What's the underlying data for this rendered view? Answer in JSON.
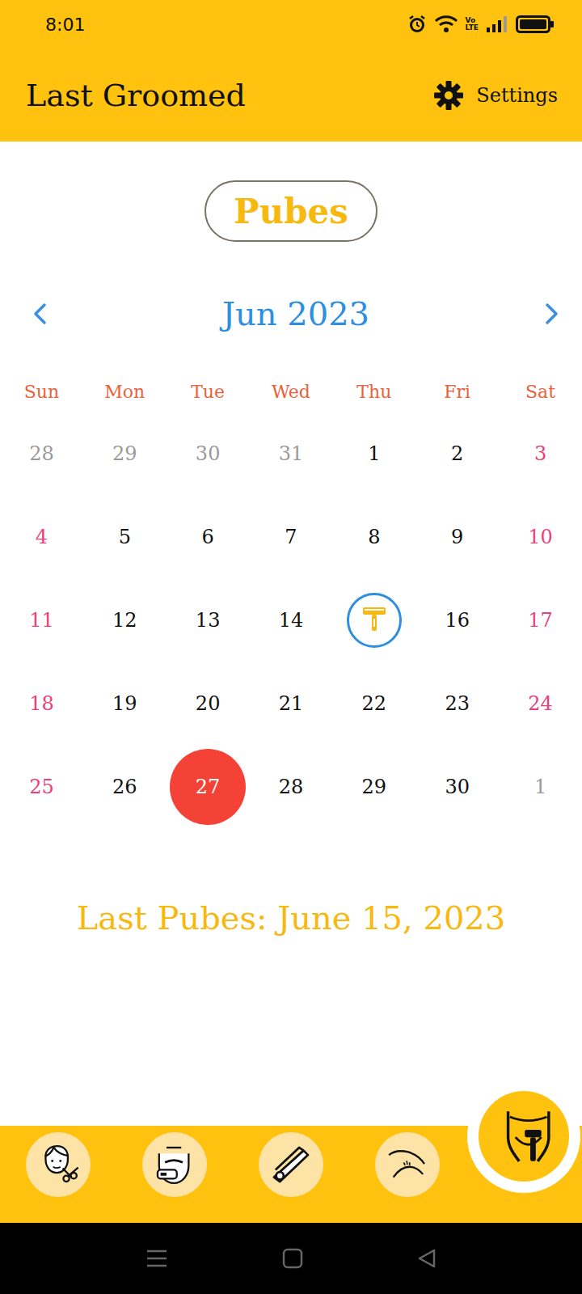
{
  "status_bar": {
    "time": "8:01",
    "network": [
      "Vo",
      "LTE"
    ]
  },
  "app_bar": {
    "title": "Last Groomed",
    "settings": "Settings"
  },
  "category": "Pubes",
  "calendar": {
    "month": "Jun 2023",
    "weekdays": [
      "Sun",
      "Mon",
      "Tue",
      "Wed",
      "Thu",
      "Fri",
      "Sat"
    ],
    "weeks": [
      [
        {
          "day": "28",
          "kind": "outside"
        },
        {
          "day": "29",
          "kind": "outside"
        },
        {
          "day": "30",
          "kind": "outside"
        },
        {
          "day": "31",
          "kind": "outside"
        },
        {
          "day": "1",
          "kind": "weekday"
        },
        {
          "day": "2",
          "kind": "weekday"
        },
        {
          "day": "3",
          "kind": "weekend"
        }
      ],
      [
        {
          "day": "4",
          "kind": "weekend"
        },
        {
          "day": "5",
          "kind": "weekday"
        },
        {
          "day": "6",
          "kind": "weekday"
        },
        {
          "day": "7",
          "kind": "weekday"
        },
        {
          "day": "8",
          "kind": "weekday"
        },
        {
          "day": "9",
          "kind": "weekday"
        },
        {
          "day": "10",
          "kind": "weekend"
        }
      ],
      [
        {
          "day": "11",
          "kind": "weekend"
        },
        {
          "day": "12",
          "kind": "weekday"
        },
        {
          "day": "13",
          "kind": "weekday"
        },
        {
          "day": "14",
          "kind": "weekday"
        },
        {
          "kind": "groomed"
        },
        {
          "day": "16",
          "kind": "weekday"
        },
        {
          "day": "17",
          "kind": "weekend"
        }
      ],
      [
        {
          "day": "18",
          "kind": "weekend"
        },
        {
          "day": "19",
          "kind": "weekday"
        },
        {
          "day": "20",
          "kind": "weekday"
        },
        {
          "day": "21",
          "kind": "weekday"
        },
        {
          "day": "22",
          "kind": "weekday"
        },
        {
          "day": "23",
          "kind": "weekday"
        },
        {
          "day": "24",
          "kind": "weekend"
        }
      ],
      [
        {
          "day": "25",
          "kind": "weekend"
        },
        {
          "day": "26",
          "kind": "weekday"
        },
        {
          "day": "27",
          "kind": "today"
        },
        {
          "day": "28",
          "kind": "weekday"
        },
        {
          "day": "29",
          "kind": "weekday"
        },
        {
          "day": "30",
          "kind": "weekday"
        },
        {
          "day": "1",
          "kind": "outside"
        }
      ]
    ]
  },
  "last_groomed": "Last Pubes: June 15, 2023",
  "nav": [
    {
      "selected": false
    },
    {
      "selected": false
    },
    {
      "selected": false
    },
    {
      "selected": false
    },
    {
      "selected": true
    }
  ]
}
